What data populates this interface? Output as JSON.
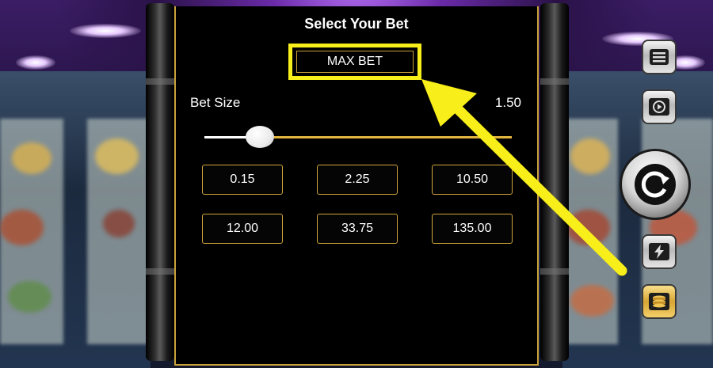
{
  "panel": {
    "title": "Select Your Bet",
    "max_bet_label": "MAX BET",
    "bet_size_label": "Bet Size",
    "bet_size_value": "1.50",
    "slider_level": 0.18,
    "bet_options": [
      "0.15",
      "2.25",
      "10.50",
      "12.00",
      "33.75",
      "135.00"
    ]
  },
  "controls": {
    "menu": "menu-icon",
    "autoplay": "autoplay-icon",
    "spin": "spin-icon",
    "turbo": "lightning-icon",
    "bet": "coin-stack-icon"
  },
  "annotation": {
    "highlight_color": "#f7ee1a",
    "arrow_color": "#f7ee1a"
  },
  "colors": {
    "gold_accent": "#d1a63b",
    "panel_bg": "#000000"
  }
}
